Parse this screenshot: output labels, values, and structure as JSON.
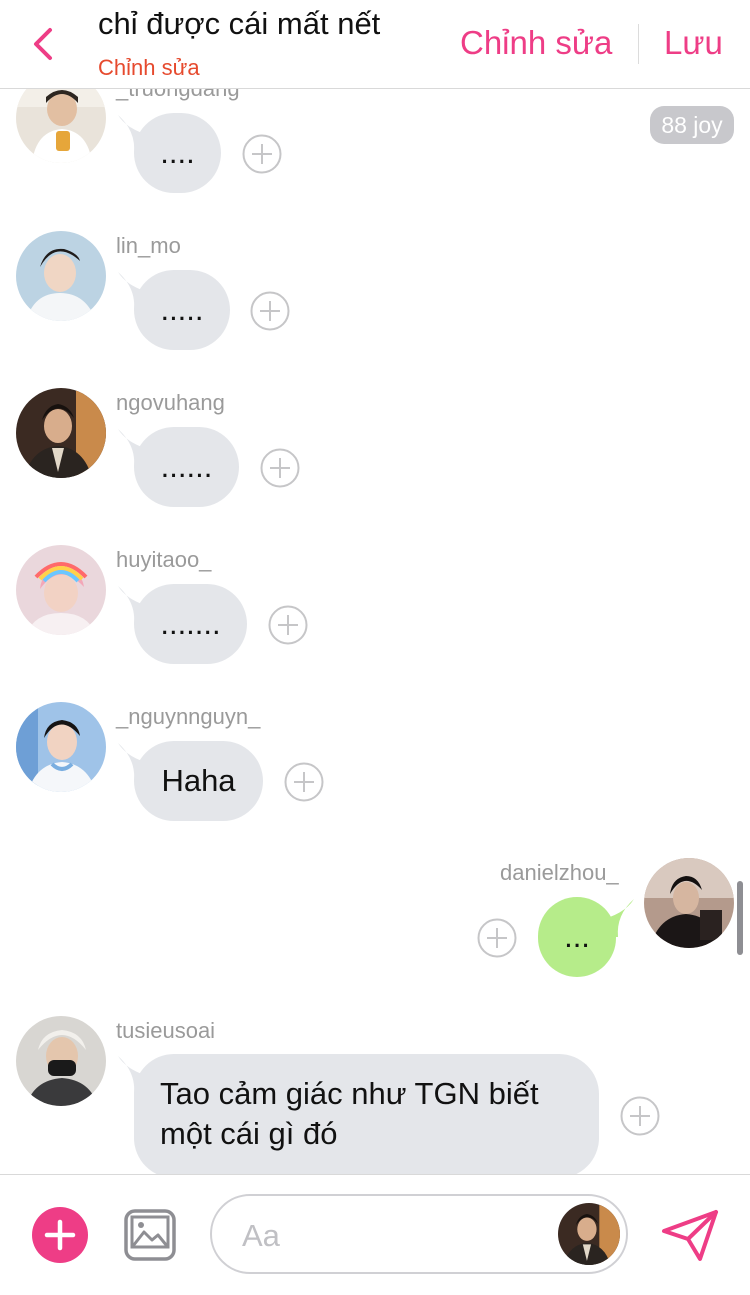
{
  "header": {
    "title": "chỉ được cái mất nết",
    "subtitle": "Chỉnh sửa",
    "edit_label": "Chỉnh sửa",
    "save_label": "Lưu"
  },
  "colors": {
    "accent": "#ee3d86",
    "subtitle": "#e64a2e",
    "bubble_in": "#e4e6ea",
    "bubble_out": "#b6ec8a",
    "meta_text": "#9a9a9a"
  },
  "joy_badge": "88 joy",
  "messages": [
    {
      "username": "_truongdang",
      "text": "....",
      "direction": "incoming"
    },
    {
      "username": "lin_mo",
      "text": ".....",
      "direction": "incoming"
    },
    {
      "username": "ngovuhang",
      "text": "......",
      "direction": "incoming"
    },
    {
      "username": "huyitaoo_",
      "text": ".......",
      "direction": "incoming"
    },
    {
      "username": "_nguynnguyn_",
      "text": "Haha",
      "direction": "incoming"
    },
    {
      "username": "danielzhou_",
      "text": "...",
      "direction": "outgoing"
    },
    {
      "username": "tusieusoai",
      "text_lines": [
        "Tao cảm giác như TGN biết",
        "một cái gì đó"
      ],
      "direction": "incoming"
    }
  ],
  "composer": {
    "placeholder": "Aa"
  },
  "icons": {
    "back": "chevron-left-icon",
    "add": "plus-icon",
    "image": "image-icon",
    "reaction": "plus-circle-icon",
    "send": "paper-plane-icon"
  }
}
